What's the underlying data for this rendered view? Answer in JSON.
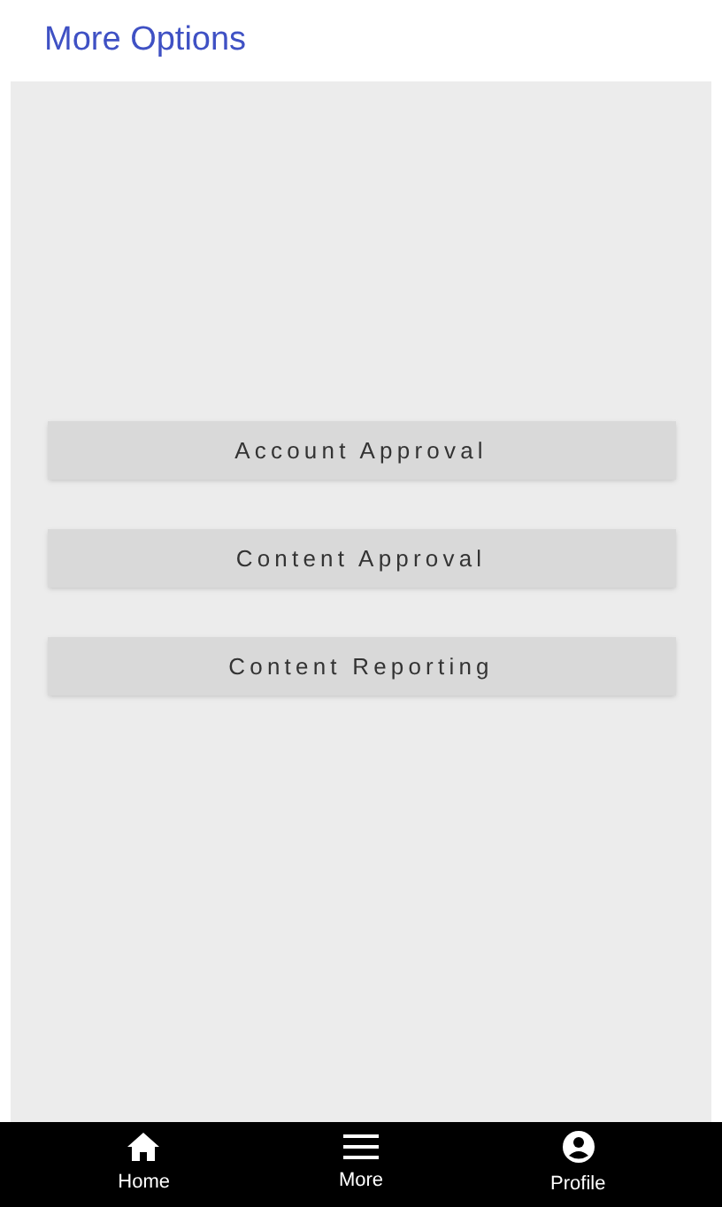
{
  "header": {
    "title": "More Options"
  },
  "options": [
    "Account Approval",
    "Content Approval",
    "Content Reporting"
  ],
  "nav": [
    {
      "kind": "home",
      "label": "Home"
    },
    {
      "kind": "menu",
      "label": "More"
    },
    {
      "kind": "profile",
      "label": "Profile"
    }
  ]
}
